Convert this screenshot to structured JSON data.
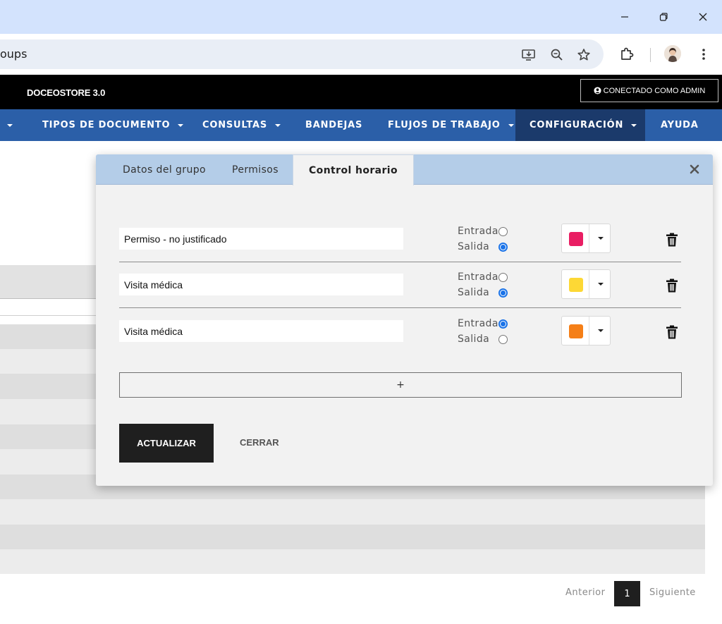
{
  "browser": {
    "url_fragment": "oups",
    "window_controls": [
      "minimize-icon",
      "restore-icon",
      "close-icon"
    ],
    "toolbar_icons": [
      "install-app-icon",
      "zoom-icon",
      "bookmark-star-icon",
      "extensions-icon",
      "profile-avatar",
      "menu-dots-icon"
    ]
  },
  "app": {
    "brand": "DOCEOSTORE 3.0",
    "login_status": "CONECTADO COMO ADMIN",
    "nav": [
      {
        "label": "TIPOS DE DOCUMENTO"
      },
      {
        "label": "CONSULTAS"
      },
      {
        "label": "BANDEJAS"
      },
      {
        "label": "FLUJOS DE TRABAJO"
      },
      {
        "label": "CONFIGURACIÓN"
      },
      {
        "label": "AYUDA"
      }
    ],
    "active_nav": "CONFIGURACIÓN"
  },
  "modal": {
    "tabs": [
      {
        "label": "Datos del grupo"
      },
      {
        "label": "Permisos"
      },
      {
        "label": "Control horario"
      }
    ],
    "active_tab": "Control horario",
    "rows": [
      {
        "name": "Permiso - no justificado",
        "entrada_label": "Entrada",
        "salida_label": "Salida",
        "selected": "Salida",
        "color": "#e91e63"
      },
      {
        "name": "Visita médica",
        "entrada_label": "Entrada",
        "salida_label": "Salida",
        "selected": "Salida",
        "color": "#fdd835"
      },
      {
        "name": "Visita médica",
        "entrada_label": "Entrada",
        "salida_label": "Salida",
        "selected": "Entrada",
        "color": "#f57f17"
      }
    ],
    "add_label": "+",
    "update_label": "ACTUALIZAR",
    "close_label": "CERRAR"
  },
  "pagination": {
    "prev": "Anterior",
    "page": "1",
    "next": "Siguiente"
  },
  "colors": {
    "nav_bg": "#2b5fa8",
    "nav_active_bg": "#1b3a6b",
    "tab_bar_bg": "#b4cde8",
    "radio_accent": "#1a73e8"
  }
}
